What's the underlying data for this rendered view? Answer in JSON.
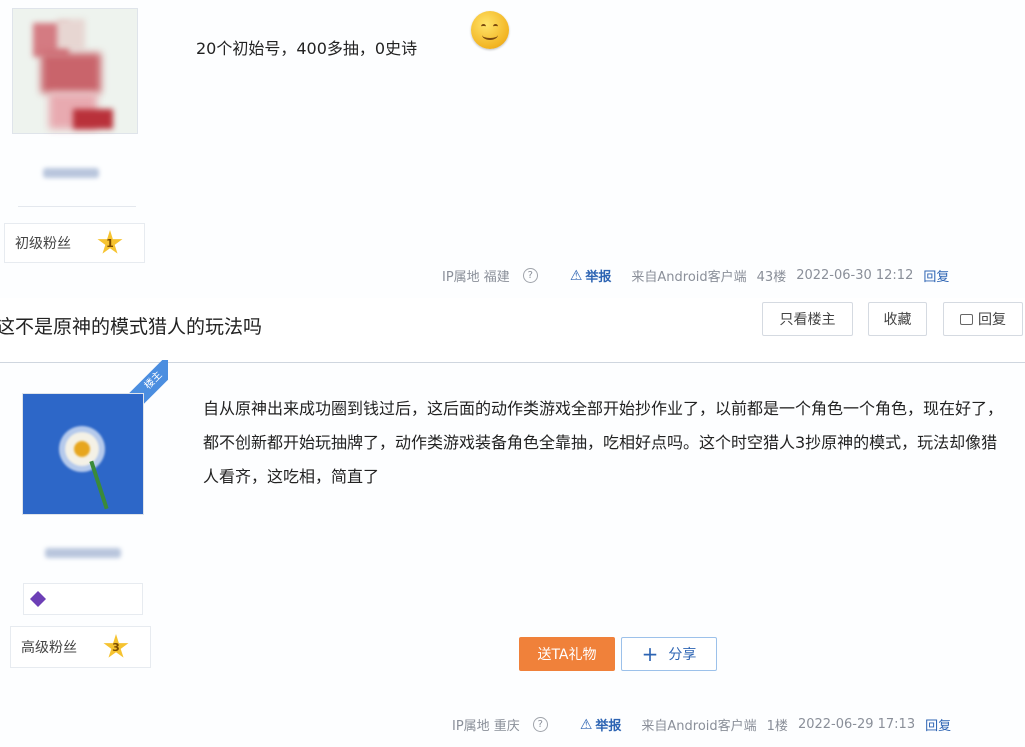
{
  "reply_post": {
    "text": "20个初始号，400多抽，0史诗",
    "user_rank": {
      "title": "初级粉丝",
      "level": "1"
    },
    "meta": {
      "ip_location": "IP属地 福建",
      "help": "?",
      "report": "举报",
      "client": "来自Android客户端",
      "floor": "43楼",
      "time": "2022-06-30 12:12",
      "reply": "回复"
    }
  },
  "thread": {
    "title": "这不是原神的模式猎人的玩法吗",
    "buttons": {
      "only_op": "只看楼主",
      "favorite": "收藏",
      "reply": "回复"
    }
  },
  "op_post": {
    "ribbon": "楼主",
    "body": "自从原神出来成功圈到钱过后，这后面的动作类游戏全部开始抄作业了，以前都是一个角色一个角色，现在好了，都不创新都开始玩抽牌了，动作类游戏装备角色全靠抽，吃相好点吗。这个时空猎人3抄原神的模式，玩法却像猎人看齐，这吃相，简直了",
    "user_rank": {
      "title": "高级粉丝",
      "level": "3"
    },
    "gift_button": "送TA礼物",
    "share_button": "分享",
    "meta": {
      "ip_location": "IP属地 重庆",
      "help": "?",
      "report": "举报",
      "client": "来自Android客户端",
      "floor": "1楼",
      "time": "2022-06-29 17:13",
      "reply": "回复"
    }
  },
  "icons": [
    "smiley-emoji-icon",
    "help-icon",
    "warning-icon",
    "star-badge-icon",
    "plus-icon",
    "level-badge-icon"
  ],
  "colors": {
    "link": "#2d64b3",
    "gift": "#f0813a",
    "star": "#f6c330",
    "ribbon": "#4b8ee0"
  }
}
